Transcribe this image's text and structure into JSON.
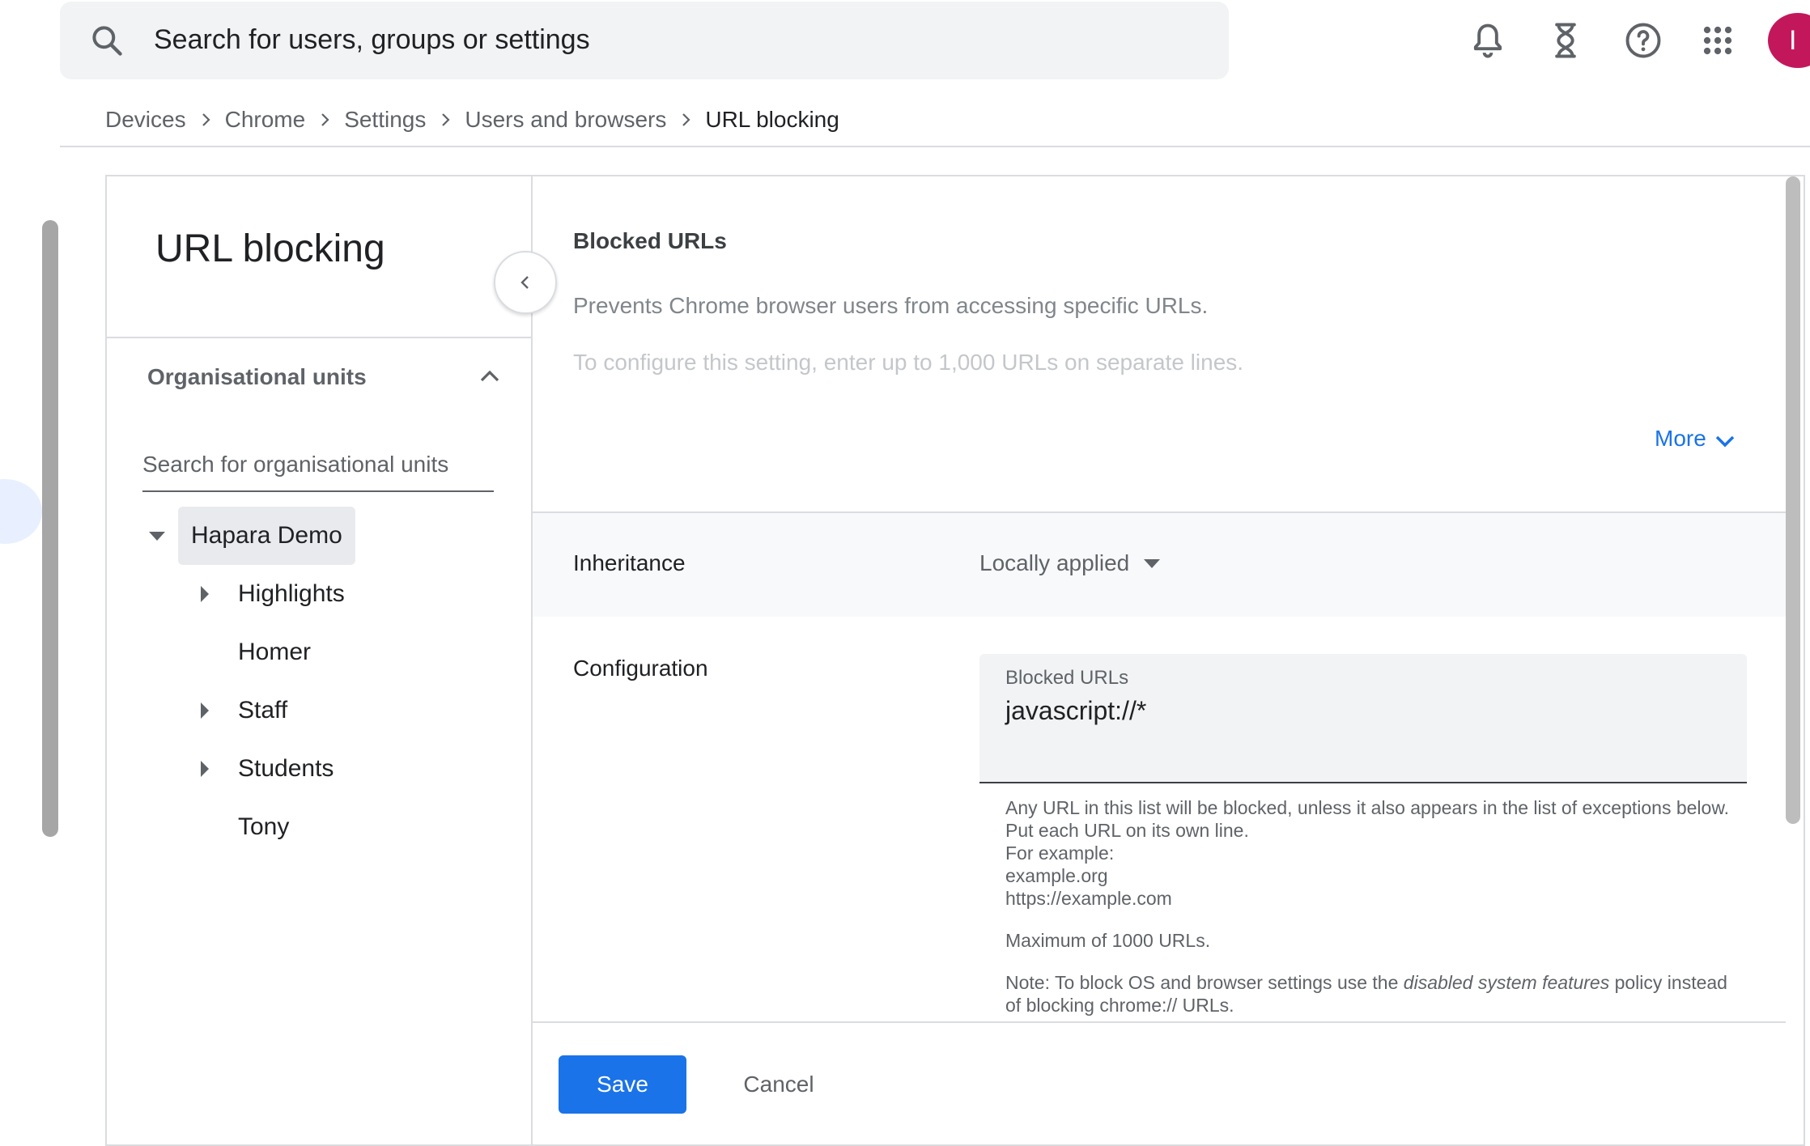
{
  "topbar": {
    "search_placeholder": "Search for users, groups or settings",
    "icons": [
      "search-icon",
      "notifications-icon",
      "hourglass-icon",
      "help-icon",
      "apps-grid-icon"
    ],
    "avatar_initial": "I",
    "avatar_color": "#c2185b"
  },
  "breadcrumb": [
    "Devices",
    "Chrome",
    "Settings",
    "Users and browsers",
    "URL blocking"
  ],
  "left_panel": {
    "title": "URL blocking",
    "ou_header": "Organisational units",
    "ou_search_placeholder": "Search for organisational units",
    "tree": {
      "root": "Hapara Demo",
      "children": [
        "Highlights",
        "Homer",
        "Staff",
        "Students",
        "Tony"
      ]
    }
  },
  "setting": {
    "title": "Blocked URLs",
    "description": "Prevents Chrome browser users from accessing specific URLs.",
    "description2": "To configure this setting, enter up to 1,000 URLs on separate lines.",
    "more_label": "More",
    "inheritance_label": "Inheritance",
    "inheritance_value": "Locally applied",
    "configuration_label": "Configuration",
    "field_label": "Blocked URLs",
    "field_value": "javascript://*",
    "help": {
      "line1": "Any URL in this list will be blocked, unless it also appears in the list of exceptions below. Put each URL on its own line.",
      "line2": "For example:",
      "line3": "example.org",
      "line4": "https://example.com",
      "max": "Maximum of 1000 URLs.",
      "note_prefix": "Note: To block OS and browser settings use the ",
      "note_em": "disabled system features",
      "note_suffix": " policy instead of blocking chrome:// URLs."
    }
  },
  "footer": {
    "save_label": "Save",
    "cancel_label": "Cancel"
  },
  "colors": {
    "accent": "#1a73e8"
  }
}
